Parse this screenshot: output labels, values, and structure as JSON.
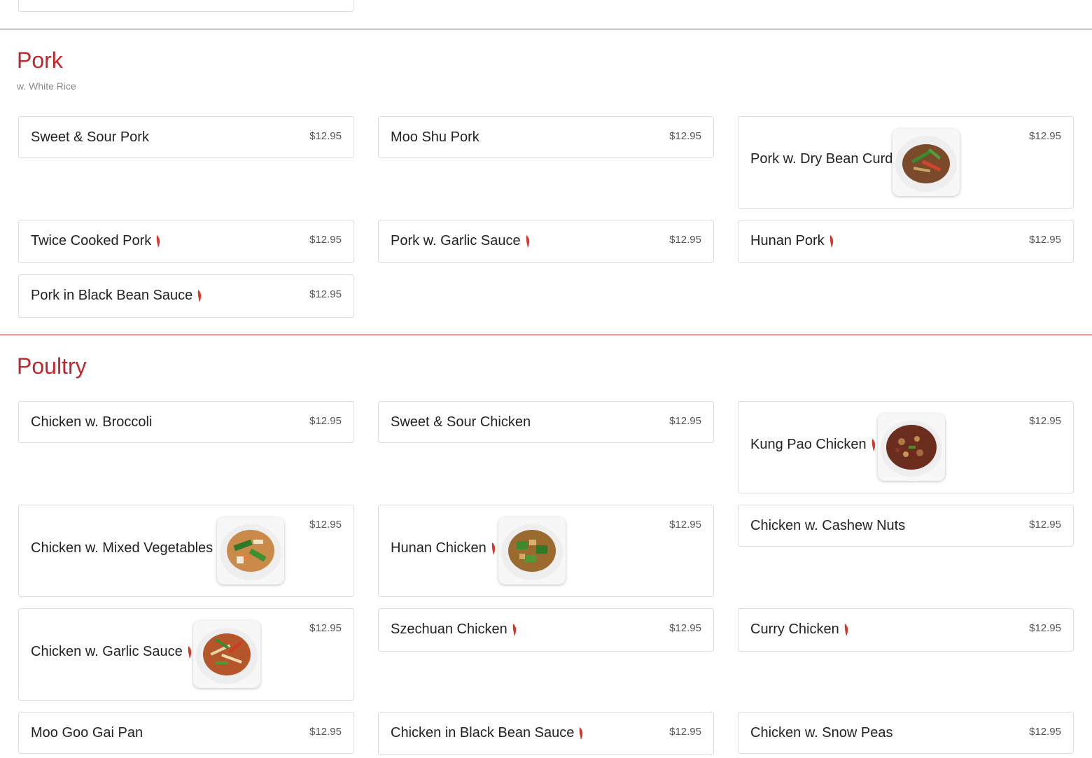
{
  "colors": {
    "accent": "#c0272d",
    "chili": "#d7382d",
    "divider": "#c8323c"
  },
  "pork": {
    "title": "Pork",
    "subtitle": "w. White Rice",
    "items": [
      {
        "name": "Sweet & Sour Pork",
        "price": "$12.95"
      },
      {
        "name": "Moo Shu Pork",
        "price": "$12.95"
      },
      {
        "name": "Pork w. Dry Bean Curd",
        "price": "$12.95",
        "image": "pork-dry-bean-curd-photo"
      },
      {
        "name": "Twice Cooked Pork",
        "price": "$12.95",
        "spicy": true
      },
      {
        "name": "Pork w. Garlic Sauce",
        "price": "$12.95",
        "spicy": true
      },
      {
        "name": "Hunan Pork",
        "price": "$12.95",
        "spicy": true
      },
      {
        "name": "Pork in Black Bean Sauce",
        "price": "$12.95",
        "spicy": true
      }
    ]
  },
  "poultry": {
    "title": "Poultry",
    "items": [
      {
        "name": "Chicken w. Broccoli",
        "price": "$12.95"
      },
      {
        "name": "Sweet & Sour Chicken",
        "price": "$12.95"
      },
      {
        "name": "Kung Pao Chicken",
        "price": "$12.95",
        "spicy": true,
        "image": "kung-pao-chicken-photo"
      },
      {
        "name": "Chicken w. Mixed Vegetables",
        "price": "$12.95",
        "image": "mixed-vegetables-chicken-photo"
      },
      {
        "name": "Hunan Chicken",
        "price": "$12.95",
        "spicy": true,
        "image": "hunan-chicken-photo"
      },
      {
        "name": "Chicken w. Cashew Nuts",
        "price": "$12.95"
      },
      {
        "name": "Chicken w. Garlic Sauce",
        "price": "$12.95",
        "spicy": true,
        "image": "garlic-sauce-chicken-photo"
      },
      {
        "name": "Szechuan Chicken",
        "price": "$12.95",
        "spicy": true
      },
      {
        "name": "Curry Chicken",
        "price": "$12.95",
        "spicy": true
      },
      {
        "name": "Moo Goo Gai Pan",
        "price": "$12.95"
      },
      {
        "name": "Chicken in Black Bean Sauce",
        "price": "$12.95",
        "spicy": true
      },
      {
        "name": "Chicken w. Snow Peas",
        "price": "$12.95"
      }
    ]
  }
}
